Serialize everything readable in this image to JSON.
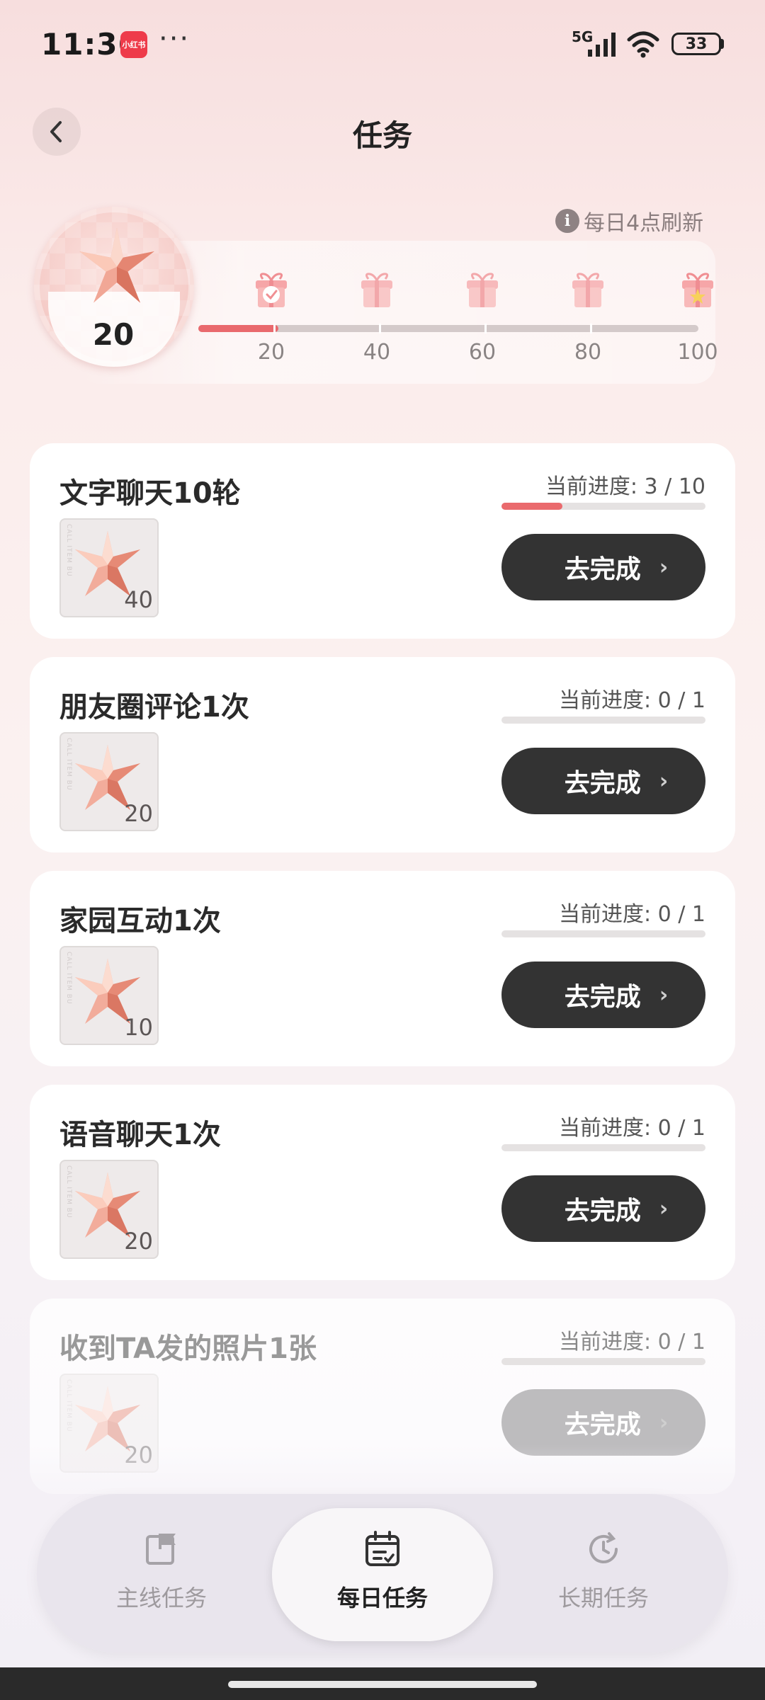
{
  "status_bar": {
    "time": "11:36",
    "app_badge": "小红书",
    "more": "···",
    "network": "5G",
    "battery": "33"
  },
  "header": {
    "title": "任务",
    "back_icon": "chevron-left-icon"
  },
  "refresh_hint": "每日4点刷新",
  "points": {
    "value": "20",
    "progress_fraction": 0.16
  },
  "milestones": [
    {
      "label": "20",
      "state": "claimed"
    },
    {
      "label": "40",
      "state": "locked"
    },
    {
      "label": "60",
      "state": "locked"
    },
    {
      "label": "80",
      "state": "locked"
    },
    {
      "label": "100",
      "state": "final"
    }
  ],
  "tasks": [
    {
      "title": "文字聊天10轮",
      "reward": "40",
      "progress_label": "当前进度: 3 / 10",
      "progress": 0.3,
      "button": "去完成"
    },
    {
      "title": "朋友圈评论1次",
      "reward": "20",
      "progress_label": "当前进度: 0 / 1",
      "progress": 0,
      "button": "去完成"
    },
    {
      "title": "家园互动1次",
      "reward": "10",
      "progress_label": "当前进度: 0 / 1",
      "progress": 0,
      "button": "去完成"
    },
    {
      "title": "语音聊天1次",
      "reward": "20",
      "progress_label": "当前进度: 0 / 1",
      "progress": 0,
      "button": "去完成"
    },
    {
      "title": "收到TA发的照片1张",
      "reward": "20",
      "progress_label": "当前进度: 0 / 1",
      "progress": 0,
      "button": "去完成"
    }
  ],
  "nav": {
    "items": [
      {
        "label": "主线任务",
        "icon": "flag-icon"
      },
      {
        "label": "每日任务",
        "icon": "calendar-icon"
      },
      {
        "label": "长期任务",
        "icon": "clock-refresh-icon"
      }
    ],
    "active_index": 1
  },
  "colors": {
    "accent": "#e9696d",
    "button": "#333333"
  }
}
